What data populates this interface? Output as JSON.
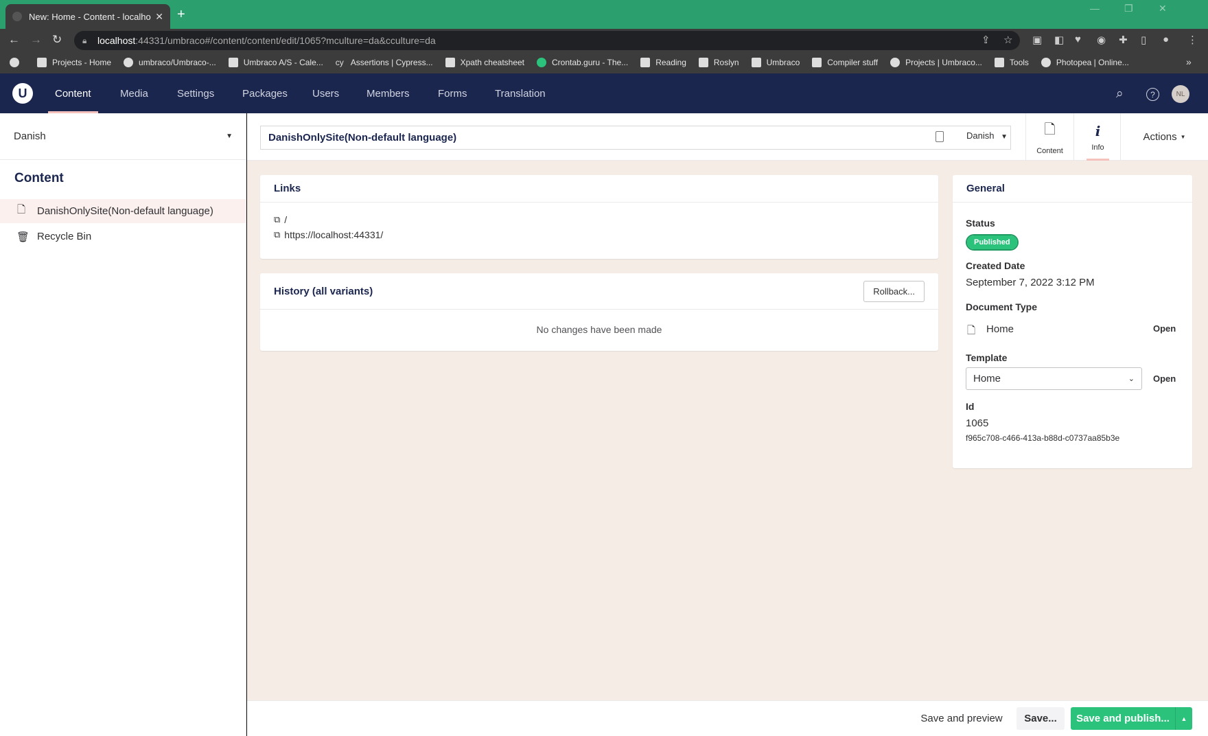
{
  "browser": {
    "tab_title": "New: Home - Content - localhost",
    "tab_close": "✕",
    "new_tab": "+",
    "url_host": "localhost",
    "url_rest": ":44331/umbraco#/content/content/edit/1065?mculture=da&cculture=da",
    "bookmarks": [
      "Projects - Home",
      "umbraco/Umbraco-...",
      "Umbraco A/S - Cale...",
      "Assertions | Cypress...",
      "Xpath cheatsheet",
      "Crontab.guru - The...",
      "Reading",
      "Roslyn",
      "Umbraco",
      "Compiler stuff",
      "Projects | Umbraco...",
      "Tools",
      "Photopea | Online..."
    ],
    "bookmarks_more": "»",
    "window_controls": [
      "—",
      "❐",
      "✕"
    ]
  },
  "header": {
    "logo": "U",
    "sections": [
      "Content",
      "Media",
      "Settings",
      "Packages",
      "Users",
      "Members",
      "Forms",
      "Translation"
    ],
    "avatar_initials": "NL"
  },
  "tree": {
    "language": "Danish",
    "title": "Content",
    "items": [
      "DanishOnlySite(Non-default language)",
      "Recycle Bin"
    ]
  },
  "editor": {
    "name": "DanishOnlySite(Non-default language)",
    "language": "Danish",
    "apps": [
      "Content",
      "Info"
    ],
    "actions_label": "Actions"
  },
  "links": {
    "title": "Links",
    "items": [
      "/",
      "https://localhost:44331/"
    ]
  },
  "history": {
    "title": "History (all variants)",
    "rollback": "Rollback...",
    "empty": "No changes have been made"
  },
  "general": {
    "title": "General",
    "status_label": "Status",
    "status": "Published",
    "created_label": "Created Date",
    "created": "September 7, 2022 3:12 PM",
    "doctype_label": "Document Type",
    "doctype": "Home",
    "open": "Open",
    "template_label": "Template",
    "template": "Home",
    "id_label": "Id",
    "id": "1065",
    "guid": "f965c708-c466-413a-b88d-c0737aa85b3e"
  },
  "footer": {
    "save_preview": "Save and preview",
    "save": "Save...",
    "save_publish": "Save and publish...",
    "arrow": "▲"
  },
  "colors": {
    "tabstrip": "#2ba06e",
    "header": "#1b264f",
    "editor_bg": "#f5ece6",
    "accent_pink": "#f5c1bc",
    "publish_green": "#2bc37c"
  }
}
